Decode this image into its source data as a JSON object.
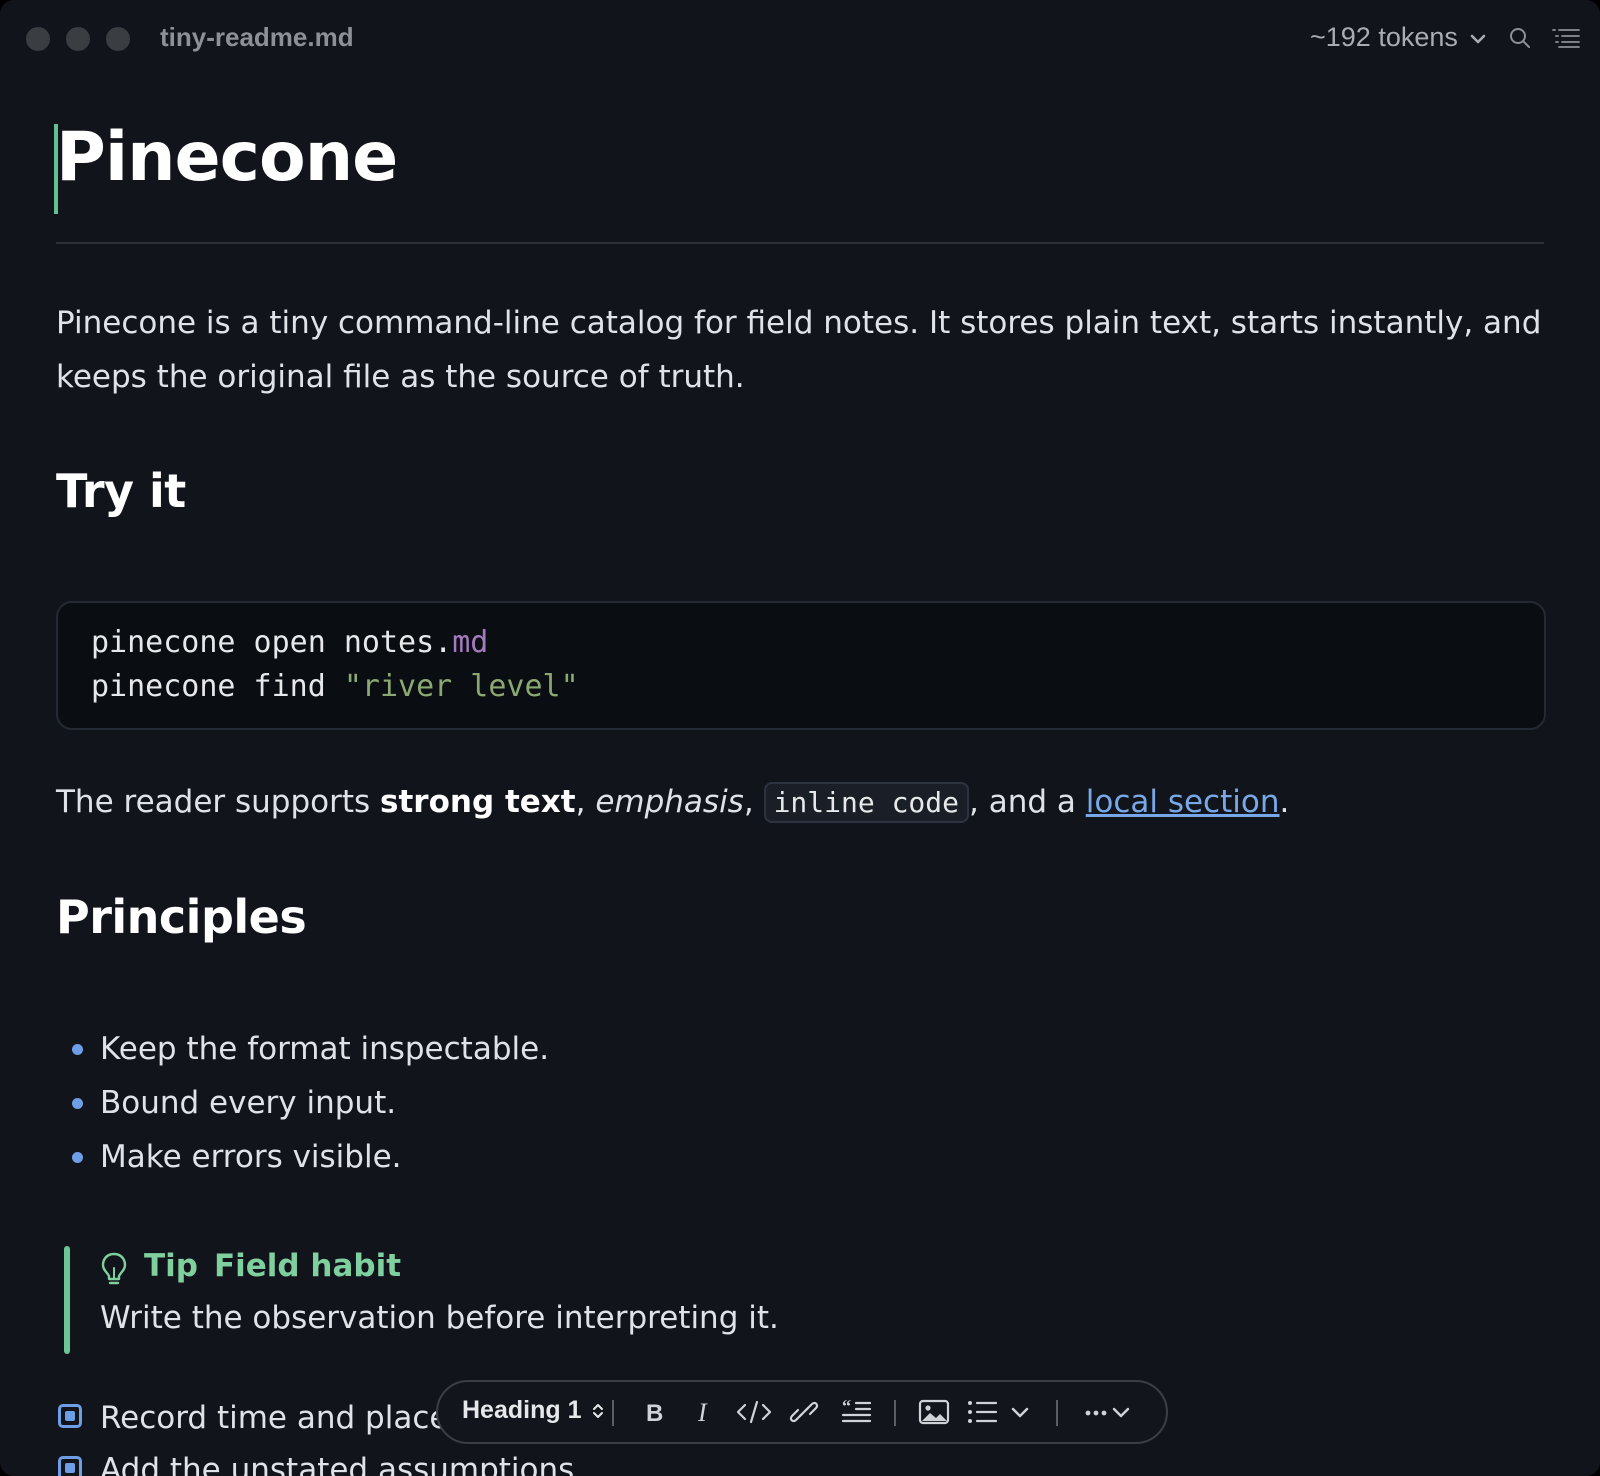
{
  "window": {
    "filename": "tiny-readme.md",
    "token_count": "~192 tokens"
  },
  "document": {
    "title": "Pinecone",
    "intro": "Pinecone is a tiny command-line catalog for field notes. It stores plain text, starts instantly, and keeps the original file as the source of truth.",
    "section_try": "Try it",
    "code": {
      "line1_cmd": "pinecone open notes",
      "line1_dot": ".",
      "line1_ext": "md",
      "line2_cmd": "pinecone find ",
      "line2_str": "\"river level\""
    },
    "inline": {
      "prefix": "The reader supports ",
      "strong": "strong text",
      "sep1": ", ",
      "emphasis": "emphasis",
      "sep2": ", ",
      "code": "inline code",
      "sep3": ", and a ",
      "link": "local section",
      "suffix": "."
    },
    "section_principles": "Principles",
    "bullets": [
      "Keep the format inspectable.",
      "Bound every input.",
      "Make errors visible."
    ],
    "callout": {
      "type": "Tip",
      "title": "Field habit",
      "body": "Write the observation before interpreting it."
    },
    "tasks": [
      "Record time and place",
      "Add the unstated assumptions"
    ]
  },
  "toolbar": {
    "block_type": "Heading 1",
    "icons": [
      "bold-icon",
      "italic-icon",
      "code-icon",
      "link-icon",
      "quote-icon",
      "image-icon",
      "list-icon",
      "more-icon"
    ]
  },
  "colors": {
    "background": "#11151b",
    "accent_green": "#6cc497",
    "link_blue": "#78a8e8",
    "bullet_blue": "#6e9fe6"
  }
}
